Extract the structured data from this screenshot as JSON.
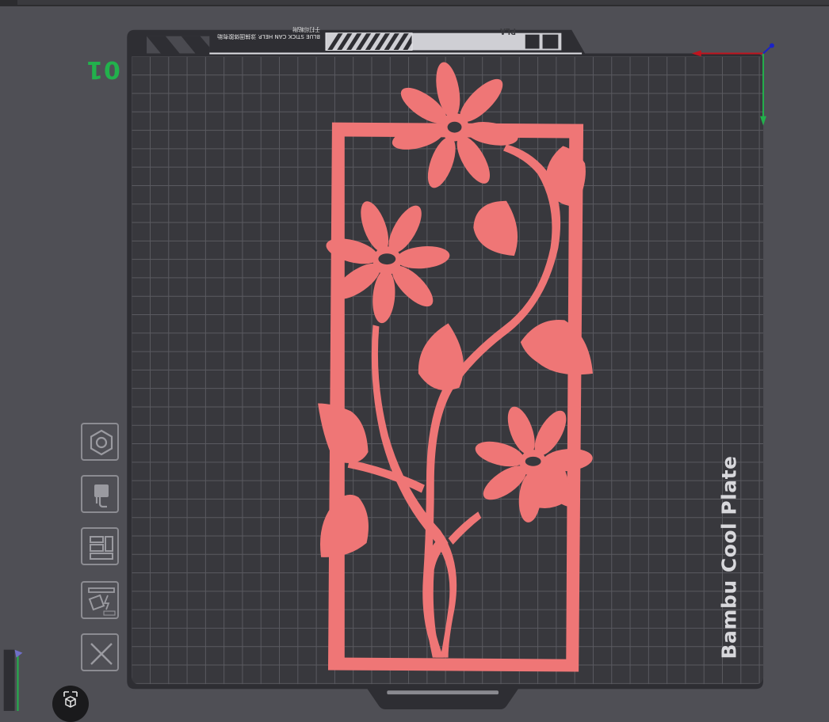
{
  "plate": {
    "number": "01",
    "label": "Bambu Cool Plate",
    "warning_text": "BLUE STICK CAN HELP. 涂抹固体胶有助于打印粘附",
    "filament_text": "PLA"
  },
  "toolbar": {
    "buttons": [
      {
        "name": "orient-tool-button",
        "icon": "hexagon-nut-icon"
      },
      {
        "name": "cut-tool-button",
        "icon": "cut-hook-icon"
      },
      {
        "name": "arrange-tool-button",
        "icon": "arrange-icon"
      },
      {
        "name": "auto-orient-button",
        "icon": "auto-orient-icon"
      },
      {
        "name": "delete-button",
        "icon": "close-x-icon"
      }
    ]
  },
  "colors": {
    "background": "#4f4f55",
    "plate": "#38383d",
    "grid": "#5a5a60",
    "model": "#ef7676",
    "axis_x": "#c0141e",
    "axis_y": "#22b14c",
    "axis_z": "#1a22c8",
    "plate_number": "#22b14c"
  },
  "model": {
    "name": "flower-panel-model"
  }
}
